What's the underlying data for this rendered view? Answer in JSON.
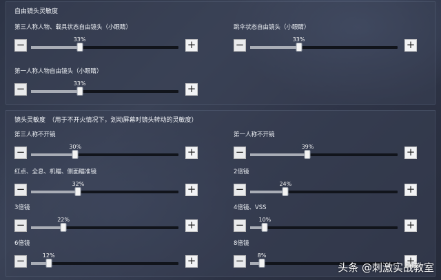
{
  "panel_free_camera": {
    "title": "自由镜头灵敏度",
    "settings": [
      {
        "label": "第三人称人物、载具状态自由镜头（小眼睛）",
        "value_text": "33%",
        "value": 0.33
      },
      {
        "label": "跳伞状态自由镜头（小眼睛）",
        "value_text": "33%",
        "value": 0.33
      },
      {
        "label": "第一人称人物自由镜头（小眼睛）",
        "value_text": "33%",
        "value": 0.33
      }
    ]
  },
  "panel_camera": {
    "title": "镜头灵敏度　（用于不开火情况下，划动屏幕时镜头转动的灵敏度）",
    "settings": [
      {
        "label": "第三人称不开镜",
        "value_text": "30%",
        "value": 0.3
      },
      {
        "label": "第一人称不开镜",
        "value_text": "39%",
        "value": 0.39
      },
      {
        "label": "红点、全息、机瞄、侧面瞄准镜",
        "value_text": "32%",
        "value": 0.32
      },
      {
        "label": "2倍镜",
        "value_text": "24%",
        "value": 0.24
      },
      {
        "label": "3倍镜",
        "value_text": "22%",
        "value": 0.22
      },
      {
        "label": "4倍镜、VSS",
        "value_text": "10%",
        "value": 0.1
      },
      {
        "label": "6倍镜",
        "value_text": "12%",
        "value": 0.12
      },
      {
        "label": "8倍镜",
        "value_text": "8%",
        "value": 0.08
      }
    ]
  },
  "controls": {
    "minus": "−",
    "plus": "+"
  },
  "watermark": "头条 @刺激实战教室"
}
